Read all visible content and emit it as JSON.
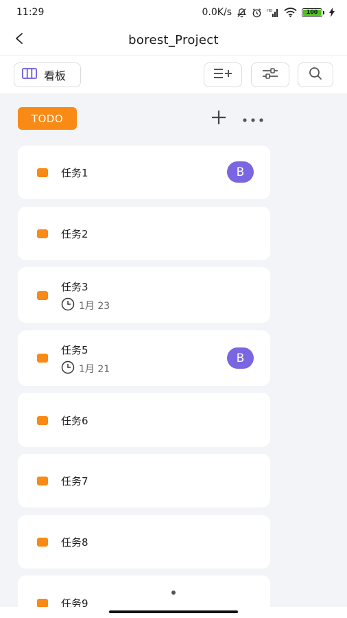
{
  "status_bar": {
    "time": "11:29",
    "network_speed": "0.0K/s",
    "battery_level": "100",
    "icons": [
      "mute-icon",
      "alarm-icon",
      "cellular-signal-icon",
      "wifi-icon",
      "battery-icon",
      "charging-icon"
    ]
  },
  "header": {
    "back_icon": "back-chevron-icon",
    "title": "borest_Project"
  },
  "toolbar": {
    "view_label": "看板",
    "view_icon": "board-columns-icon",
    "add_list_icon": "list-add-icon",
    "filter_icon": "filter-sliders-icon",
    "search_icon": "search-icon"
  },
  "column": {
    "status": "TODO",
    "add_icon": "plus-icon",
    "more_icon": "more-dots-icon"
  },
  "tasks": [
    {
      "title": "任务1",
      "due": "",
      "assignee": "B"
    },
    {
      "title": "任务2",
      "due": "",
      "assignee": ""
    },
    {
      "title": "任务3",
      "due": "1月 23",
      "assignee": ""
    },
    {
      "title": "任务5",
      "due": "1月 21",
      "assignee": "B"
    },
    {
      "title": "任务6",
      "due": "",
      "assignee": ""
    },
    {
      "title": "任务7",
      "due": "",
      "assignee": ""
    },
    {
      "title": "任务8",
      "due": "",
      "assignee": ""
    },
    {
      "title": "任务9",
      "due": "",
      "assignee": ""
    }
  ],
  "colors": {
    "accent": "#f98a15",
    "avatar": "#7a65e2",
    "board_background": "#f3f4f7",
    "view_icon": "#6b5bd6"
  }
}
